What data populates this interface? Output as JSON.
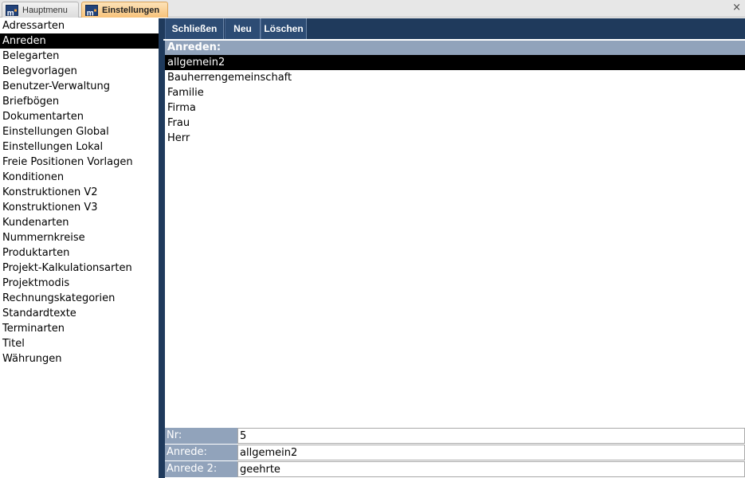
{
  "tabs": [
    {
      "label": "Hauptmenu",
      "logo": "m"
    },
    {
      "label": "Einstellungen",
      "logo": "m"
    }
  ],
  "close_glyph": "×",
  "sidebar": {
    "items": [
      "Adressarten",
      "Anreden",
      "Belegarten",
      "Belegvorlagen",
      "Benutzer-Verwaltung",
      "Briefbögen",
      "Dokumentarten",
      "Einstellungen Global",
      "Einstellungen Lokal",
      "Freie Positionen Vorlagen",
      "Konditionen",
      "Konstruktionen V2",
      "Konstruktionen V3",
      "Kundenarten",
      "Nummernkreise",
      "Produktarten",
      "Projekt-Kalkulationsarten",
      "Projektmodis",
      "Rechnungskategorien",
      "Standardtexte",
      "Terminarten",
      "Titel",
      "Währungen"
    ],
    "selected_index": 1
  },
  "toolbar": {
    "close_label": "Schließen",
    "new_label": "Neu",
    "delete_label": "Löschen"
  },
  "list": {
    "header": "Anreden:",
    "items": [
      "allgemein2",
      "Bauherrengemeinschaft",
      "Familie",
      "Firma",
      "Frau",
      "Herr"
    ],
    "selected_index": 0
  },
  "detail": {
    "nr_label": "Nr:",
    "nr_value": "5",
    "anrede_label": "Anrede:",
    "anrede_value": "allgemein2",
    "anrede2_label": "Anrede 2:",
    "anrede2_value": "geehrte"
  },
  "colors": {
    "navy": "#1f3a5c",
    "label_bg": "#91a3bb",
    "active_tab": "#f7c27a"
  }
}
